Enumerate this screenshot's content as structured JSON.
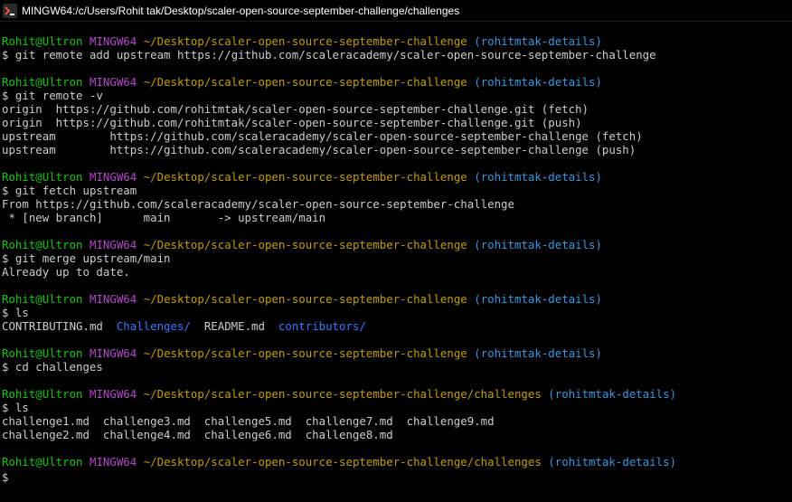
{
  "window": {
    "title": "MINGW64:/c/Users/Rohit tak/Desktop/scaler-open-source-september-challenge/challenges"
  },
  "colors": {
    "user": "#16c60c",
    "shell": "#b148c6",
    "path": "#c19c00",
    "branch": "#3a96dd",
    "dir": "#3b78ff",
    "text": "#cccccc",
    "background": "#000000"
  },
  "terminal": {
    "p1": {
      "user": "Rohit@Ultron",
      "shell": "MINGW64",
      "path": "~/Desktop/scaler-open-source-september-challenge",
      "branch": "(rohitmtak-details)"
    },
    "c1": "$ git remote add upstream https://github.com/scaleracademy/scaler-open-source-september-challenge",
    "p2": {
      "user": "Rohit@Ultron",
      "shell": "MINGW64",
      "path": "~/Desktop/scaler-open-source-september-challenge",
      "branch": "(rohitmtak-details)"
    },
    "c2": "$ git remote -v",
    "o2": [
      "origin  https://github.com/rohitmtak/scaler-open-source-september-challenge.git (fetch)",
      "origin  https://github.com/rohitmtak/scaler-open-source-september-challenge.git (push)",
      "upstream        https://github.com/scaleracademy/scaler-open-source-september-challenge (fetch)",
      "upstream        https://github.com/scaleracademy/scaler-open-source-september-challenge (push)"
    ],
    "p3": {
      "user": "Rohit@Ultron",
      "shell": "MINGW64",
      "path": "~/Desktop/scaler-open-source-september-challenge",
      "branch": "(rohitmtak-details)"
    },
    "c3": "$ git fetch upstream",
    "o3": [
      "From https://github.com/scaleracademy/scaler-open-source-september-challenge",
      " * [new branch]      main       -> upstream/main"
    ],
    "p4": {
      "user": "Rohit@Ultron",
      "shell": "MINGW64",
      "path": "~/Desktop/scaler-open-source-september-challenge",
      "branch": "(rohitmtak-details)"
    },
    "c4": "$ git merge upstream/main",
    "o4": "Already up to date.",
    "p5": {
      "user": "Rohit@Ultron",
      "shell": "MINGW64",
      "path": "~/Desktop/scaler-open-source-september-challenge",
      "branch": "(rohitmtak-details)"
    },
    "c5": "$ ls",
    "o5": {
      "f1": "CONTRIBUTING.md",
      "d1": "Challenges/",
      "f2": "README.md",
      "d2": "contributors/"
    },
    "p6": {
      "user": "Rohit@Ultron",
      "shell": "MINGW64",
      "path": "~/Desktop/scaler-open-source-september-challenge",
      "branch": "(rohitmtak-details)"
    },
    "c6": "$ cd challenges",
    "p7": {
      "user": "Rohit@Ultron",
      "shell": "MINGW64",
      "path": "~/Desktop/scaler-open-source-september-challenge/challenges",
      "branch": "(rohitmtak-details)"
    },
    "c7": "$ ls",
    "o7": [
      "challenge1.md  challenge3.md  challenge5.md  challenge7.md  challenge9.md",
      "challenge2.md  challenge4.md  challenge6.md  challenge8.md"
    ],
    "p8": {
      "user": "Rohit@Ultron",
      "shell": "MINGW64",
      "path": "~/Desktop/scaler-open-source-september-challenge/challenges",
      "branch": "(rohitmtak-details)"
    },
    "c8": "$"
  }
}
